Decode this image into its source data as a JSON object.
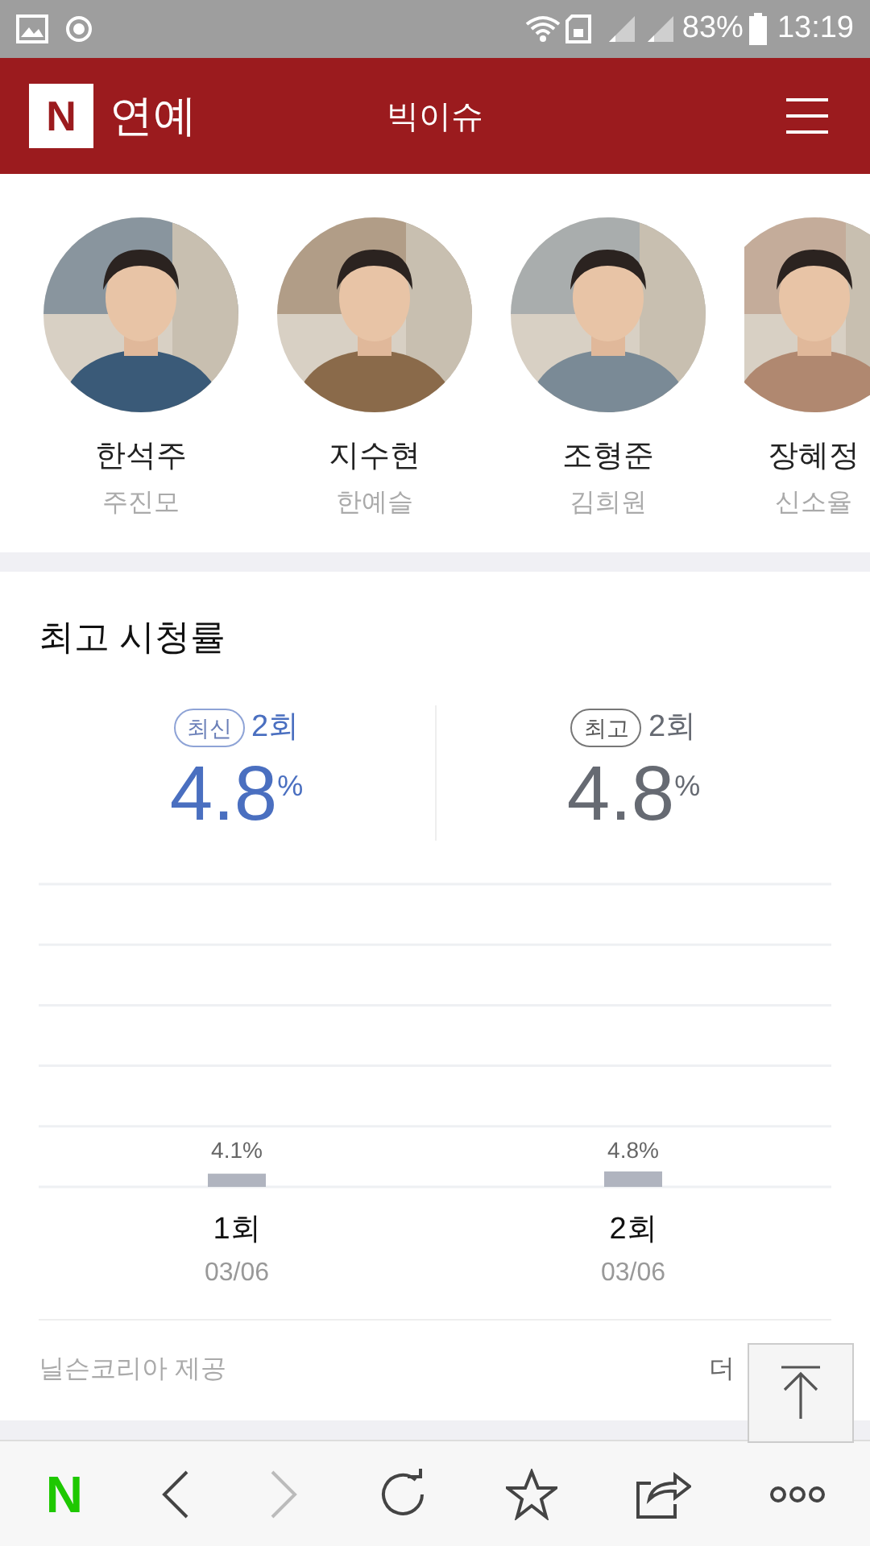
{
  "status_bar": {
    "battery": "83%",
    "time": "13:19"
  },
  "header": {
    "logo": "N",
    "section": "연예",
    "title": "빅이슈"
  },
  "cast": [
    {
      "actor": "한석주",
      "role": "주진모",
      "kind": "picture"
    },
    {
      "actor": "지수현",
      "role": "한예슬",
      "kind": "picture"
    },
    {
      "actor": "조형준",
      "role": "김희원",
      "kind": "picture"
    },
    {
      "actor": "장혜정",
      "role": "신소율",
      "kind": "picture"
    }
  ],
  "ratings": {
    "title": "최고 시청률",
    "stats": [
      {
        "kind": "latest",
        "badge": "최신",
        "episode": "2회",
        "value": "4.8",
        "unit": "%"
      },
      {
        "kind": "best",
        "badge": "최고",
        "episode": "2회",
        "value": "4.8",
        "unit": "%"
      }
    ],
    "chart_data": {
      "type": "bar",
      "categories": [
        "1회",
        "2회"
      ],
      "values": [
        4.1,
        4.8
      ],
      "data_labels": true,
      "value_labels": [
        "4.1%",
        "4.8%"
      ]
    },
    "dates": [
      "03/06",
      "03/06"
    ],
    "source": "닐슨코리아 제공",
    "more": "더"
  },
  "toolbar": {
    "logo": "N"
  }
}
